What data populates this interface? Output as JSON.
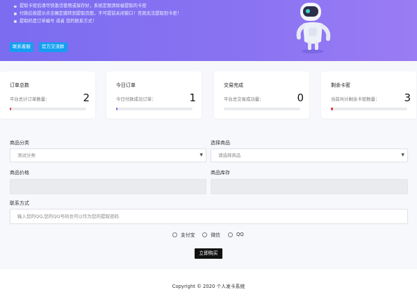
{
  "notice": {
    "items": [
      "提取卡密后请尽快激活使用或保存好，系统定期清除被提取的卡密",
      "付款后按提示点击确定跳转到提取页面，不可提前关闭窗口！否则无法提取到卡密！",
      "提取码是订单编号 或者 您的联系方式！"
    ],
    "support_button": "联系客服",
    "group_button": "官方交流群"
  },
  "stats": [
    {
      "title": "订单总数",
      "label": "平台总计订单数量：",
      "value": "2",
      "fill": 0.02,
      "color": "#e5323a"
    },
    {
      "title": "今日订单",
      "label": "今日付款成功订单：",
      "value": "1",
      "fill": 0.01,
      "color": "#7b6cf0"
    },
    {
      "title": "交易完成",
      "label": "平台总交易成功量：",
      "value": "0",
      "fill": 0.0,
      "color": "#139ff2"
    },
    {
      "title": "剩余卡密",
      "label": "当前共计剩余卡密数量：",
      "value": "3",
      "fill": 0.03,
      "color": "#e5323a"
    }
  ],
  "form": {
    "category_label": "商品分类",
    "category_value": "测试分类",
    "product_label": "选择商品",
    "product_placeholder": "请选择商品",
    "price_label": "商品价格",
    "stock_label": "商品库存",
    "contact_label": "联系方式",
    "contact_placeholder": "输入您的QQ,您的QQ号码也可以作为您的提取密码",
    "payment_options": [
      "支付宝",
      "微信",
      "QQ"
    ],
    "buy_button": "立即购买"
  },
  "footer": {
    "copyright": "Copyright © 2020 个人发卡系统"
  }
}
